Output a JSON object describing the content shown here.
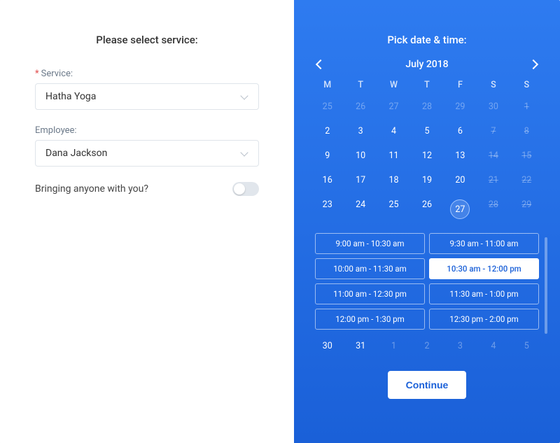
{
  "left": {
    "title": "Please select service:",
    "service_label": "Service:",
    "service_value": "Hatha Yoga",
    "employee_label": "Employee:",
    "employee_value": "Dana Jackson",
    "toggle_label": "Bringing anyone with you?"
  },
  "right": {
    "title": "Pick date & time:",
    "month_label": "July 2018",
    "dow": [
      "M",
      "T",
      "W",
      "T",
      "F",
      "S",
      "S"
    ],
    "weeks": [
      [
        {
          "d": "25",
          "state": "outside"
        },
        {
          "d": "26",
          "state": "outside"
        },
        {
          "d": "27",
          "state": "outside"
        },
        {
          "d": "28",
          "state": "outside"
        },
        {
          "d": "29",
          "state": "outside"
        },
        {
          "d": "30",
          "state": "outside"
        },
        {
          "d": "1",
          "state": "disabled"
        }
      ],
      [
        {
          "d": "2",
          "state": "normal"
        },
        {
          "d": "3",
          "state": "normal"
        },
        {
          "d": "4",
          "state": "normal"
        },
        {
          "d": "5",
          "state": "normal"
        },
        {
          "d": "6",
          "state": "normal"
        },
        {
          "d": "7",
          "state": "disabled"
        },
        {
          "d": "8",
          "state": "disabled"
        }
      ],
      [
        {
          "d": "9",
          "state": "normal"
        },
        {
          "d": "10",
          "state": "normal"
        },
        {
          "d": "11",
          "state": "normal"
        },
        {
          "d": "12",
          "state": "normal"
        },
        {
          "d": "13",
          "state": "normal"
        },
        {
          "d": "14",
          "state": "disabled"
        },
        {
          "d": "15",
          "state": "disabled"
        }
      ],
      [
        {
          "d": "16",
          "state": "normal"
        },
        {
          "d": "17",
          "state": "normal"
        },
        {
          "d": "18",
          "state": "normal"
        },
        {
          "d": "19",
          "state": "normal"
        },
        {
          "d": "20",
          "state": "normal"
        },
        {
          "d": "21",
          "state": "disabled"
        },
        {
          "d": "22",
          "state": "disabled"
        }
      ],
      [
        {
          "d": "23",
          "state": "normal"
        },
        {
          "d": "24",
          "state": "normal"
        },
        {
          "d": "25",
          "state": "normal"
        },
        {
          "d": "26",
          "state": "normal"
        },
        {
          "d": "27",
          "state": "selected"
        },
        {
          "d": "28",
          "state": "disabled"
        },
        {
          "d": "29",
          "state": "disabled"
        }
      ],
      [
        {
          "d": "30",
          "state": "normal"
        },
        {
          "d": "31",
          "state": "normal"
        },
        {
          "d": "1",
          "state": "outside"
        },
        {
          "d": "2",
          "state": "outside"
        },
        {
          "d": "3",
          "state": "outside"
        },
        {
          "d": "4",
          "state": "outside"
        },
        {
          "d": "5",
          "state": "outside"
        }
      ]
    ],
    "slots": [
      {
        "label": "9:00 am - 10:30 am",
        "selected": false
      },
      {
        "label": "9:30 am - 11:00 am",
        "selected": false
      },
      {
        "label": "10:00 am - 11:30 am",
        "selected": false
      },
      {
        "label": "10:30 am - 12:00 pm",
        "selected": true
      },
      {
        "label": "11:00 am - 12:30 pm",
        "selected": false
      },
      {
        "label": "11:30 am - 1:00 pm",
        "selected": false
      },
      {
        "label": "12:00 pm - 1:30 pm",
        "selected": false
      },
      {
        "label": "12:30 pm - 2:00 pm",
        "selected": false
      }
    ],
    "continue_label": "Continue"
  }
}
